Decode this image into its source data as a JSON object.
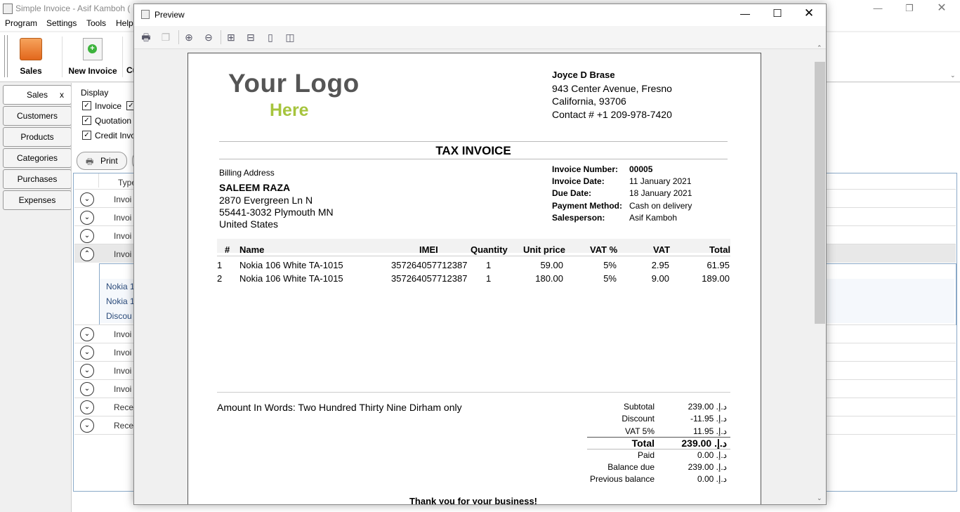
{
  "app": {
    "title": "Simple Invoice - Asif Kamboh (",
    "menu": [
      "Program",
      "Settings",
      "Tools",
      "Help"
    ],
    "ribbon": {
      "sales": "Sales",
      "new_invoice": "New Invoice",
      "cut": "Cu"
    },
    "tabs": {
      "sales": "Sales",
      "sales_close": "x",
      "customers": "Customers",
      "products": "Products",
      "categories": "Categories",
      "purchases": "Purchases",
      "expenses": "Expenses"
    },
    "display": {
      "label": "Display",
      "invoice": "Invoice",
      "quotation": "Quotation",
      "credit": "Credit Invo"
    },
    "print_label": "Print",
    "column_type": "Type",
    "rows": [
      "Invoi",
      "Invoi",
      "Invoi",
      "Invoi",
      "Invoi",
      "Invoi",
      "Invoi",
      "Invoi",
      "Recei",
      "Recei"
    ],
    "expanded_items": [
      "Nokia 1",
      "Nokia 1",
      "Discou"
    ]
  },
  "preview": {
    "title": "Preview",
    "company": {
      "name": "Joyce D Brase",
      "address1": "943  Center Avenue, Fresno",
      "address2": "California, 93706",
      "contact": "Contact # +1 209-978-7420"
    },
    "logo": {
      "line1": "Your Logo",
      "line2": "Here"
    },
    "doc_title": "TAX INVOICE",
    "billing": {
      "label": "Billing Address",
      "name": "SALEEM RAZA",
      "line1": "2870 Evergreen Ln N",
      "line2": "55441-3032  Plymouth   MN",
      "line3": "United States"
    },
    "meta": {
      "number_label": "Invoice Number:",
      "number": "00005",
      "date_label": "Invoice Date:",
      "date": "11 January 2021",
      "due_label": "Due Date:",
      "due": "18 January 2021",
      "method_label": "Payment Method:",
      "method": "Cash on delivery",
      "sales_label": "Salesperson:",
      "salesperson": "Asif Kamboh"
    },
    "table": {
      "headers": {
        "num": "#",
        "name": "Name",
        "imei": "IMEI",
        "qty": "Quantity",
        "price": "Unit price",
        "vatp": "VAT %",
        "vat": "VAT",
        "total": "Total"
      },
      "rows": [
        {
          "num": "1",
          "name": "Nokia 106 White TA-1015",
          "imei": "357264057712387",
          "qty": "1",
          "price": "59.00",
          "vatp": "5%",
          "vat": "2.95",
          "total": "61.95"
        },
        {
          "num": "2",
          "name": "Nokia 106 White TA-1015",
          "imei": "357264057712387",
          "qty": "1",
          "price": "180.00",
          "vatp": "5%",
          "vat": "9.00",
          "total": "189.00"
        }
      ]
    },
    "amount_words": "Amount In Words: Two Hundred Thirty Nine Dirham only",
    "totals": {
      "subtotal_label": "Subtotal",
      "subtotal": "239.00 .د.إ",
      "discount_label": "Discount",
      "discount": "-11.95 .د.إ",
      "vat_label": "VAT 5%",
      "vat": "11.95 .د.إ",
      "total_label": "Total",
      "total": "239.00 .د.إ",
      "paid_label": "Paid",
      "paid": "0.00 .د.إ",
      "balance_label": "Balance due",
      "balance": "239.00 .د.إ",
      "prev_label": "Previous balance",
      "prev": "0.00 .د.إ"
    },
    "thanks": "Thank you for your business!"
  }
}
